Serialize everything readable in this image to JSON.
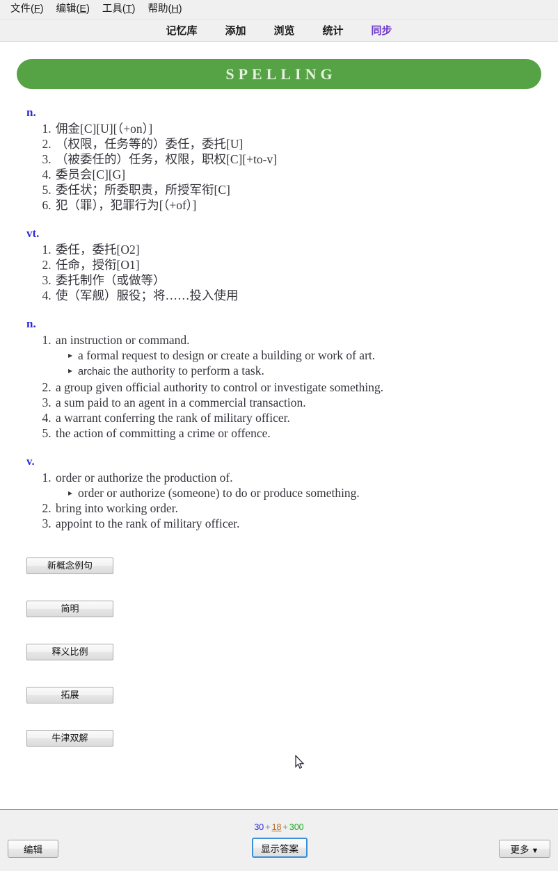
{
  "menubar": {
    "items": [
      {
        "label": "文件",
        "accel": "F"
      },
      {
        "label": "编辑",
        "accel": "E"
      },
      {
        "label": "工具",
        "accel": "T"
      },
      {
        "label": "帮助",
        "accel": "H"
      }
    ]
  },
  "navbar": {
    "links": [
      {
        "label": "记忆库",
        "active": false
      },
      {
        "label": "添加",
        "active": false
      },
      {
        "label": "浏览",
        "active": false
      },
      {
        "label": "统计",
        "active": false
      },
      {
        "label": "同步",
        "active": true
      }
    ],
    "active_color": "#6b35c9"
  },
  "card": {
    "banner": {
      "title": "SPELLING",
      "bg_color": "#55a344",
      "text_color": "#e7f3e0"
    },
    "sections": [
      {
        "pos": "n.",
        "senses": [
          {
            "text": "佣金[C][U][（+on）]"
          },
          {
            "text": "（权限，任务等的）委任，委托[U]"
          },
          {
            "text": "（被委任的）任务，权限，职权[C][+to-v]"
          },
          {
            "text": "委员会[C][G]"
          },
          {
            "text": "委任状；所委职责，所授军衔[C]"
          },
          {
            "text": "犯（罪），犯罪行为[（+of）]"
          }
        ]
      },
      {
        "pos": "vt.",
        "senses": [
          {
            "text": "委任，委托[O2]"
          },
          {
            "text": "任命，授衔[O1]"
          },
          {
            "text": "委托制作（或做等）"
          },
          {
            "text": "使（军舰）服役；将……投入使用"
          }
        ]
      },
      {
        "pos": "n.",
        "senses": [
          {
            "text": "an instruction or command.",
            "subs": [
              {
                "tag": "",
                "text": "a formal request to design or create a building or work of art."
              },
              {
                "tag": "archaic",
                "text": "the authority to perform a task."
              }
            ]
          },
          {
            "text": "a group given official authority to control or investigate something."
          },
          {
            "text": "a sum paid to an agent in a commercial transaction."
          },
          {
            "text": "a warrant conferring the rank of military officer."
          },
          {
            "text": "the action of committing a crime or offence."
          }
        ]
      },
      {
        "pos": "v.",
        "senses": [
          {
            "text": "order or authorize the production of.",
            "subs": [
              {
                "tag": "",
                "text": "order or authorize (someone) to do or produce something."
              }
            ]
          },
          {
            "text": "bring into working order."
          },
          {
            "text": "appoint to the rank of military officer."
          }
        ]
      }
    ],
    "extra_buttons": [
      {
        "label": "新概念例句"
      },
      {
        "label": "简明"
      },
      {
        "label": "释义比例"
      },
      {
        "label": "拓展"
      },
      {
        "label": "牛津双解"
      }
    ]
  },
  "bottombar": {
    "counts": {
      "new": "30",
      "learning": "18",
      "review": "300",
      "separator": "+"
    },
    "edit_label": "编辑",
    "show_answer_label": "显示答案",
    "more_label": "更多",
    "more_caret": "▼"
  }
}
